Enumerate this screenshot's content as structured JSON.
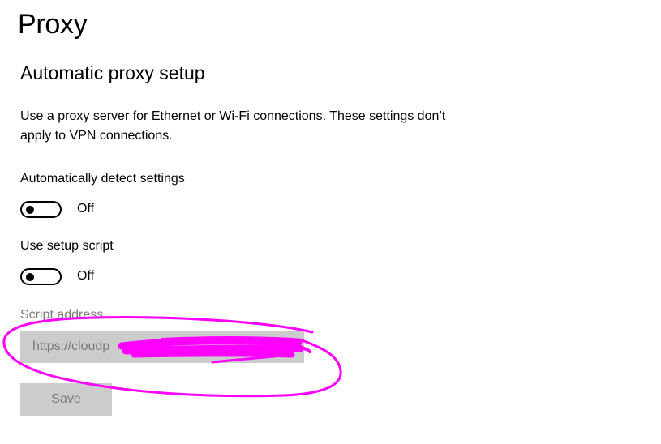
{
  "page": {
    "title": "Proxy"
  },
  "automatic_setup": {
    "heading": "Automatic proxy setup",
    "description": "Use a proxy server for Ethernet or Wi-Fi connections. These settings don’t apply to VPN connections.",
    "auto_detect": {
      "label": "Automatically detect settings",
      "state": "Off"
    },
    "setup_script": {
      "label": "Use setup script",
      "state": "Off"
    },
    "script_address": {
      "label": "Script address",
      "value": "https://cloudp"
    },
    "save_label": "Save"
  },
  "colors": {
    "disabled_fill": "#cccccc",
    "disabled_text": "#7a7a7a",
    "annotation": "#ff00ff"
  }
}
